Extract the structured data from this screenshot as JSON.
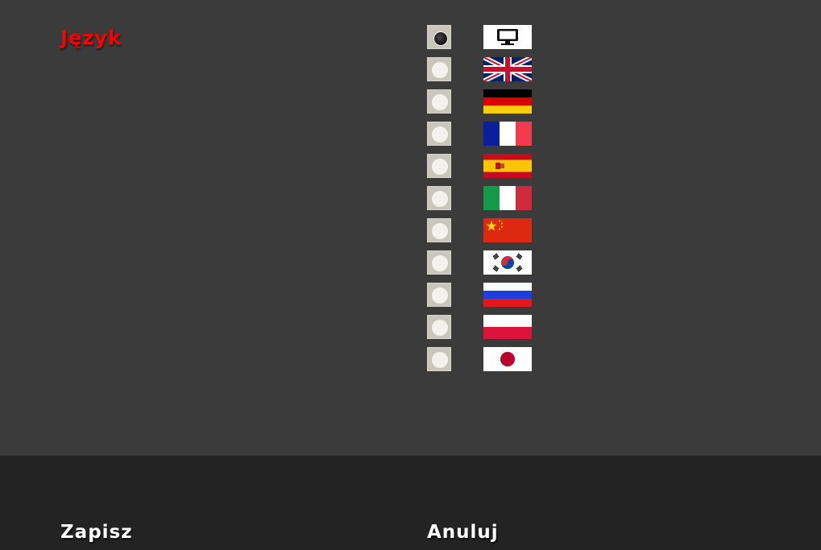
{
  "settings": {
    "title": "Język",
    "title_color": "#ff0000"
  },
  "languages": [
    {
      "flag": "monitor-icon",
      "selected": true
    },
    {
      "flag": "flag-uk",
      "selected": false
    },
    {
      "flag": "flag-germany",
      "selected": false
    },
    {
      "flag": "flag-france",
      "selected": false
    },
    {
      "flag": "flag-spain",
      "selected": false
    },
    {
      "flag": "flag-italy",
      "selected": false
    },
    {
      "flag": "flag-china",
      "selected": false
    },
    {
      "flag": "flag-south-korea",
      "selected": false
    },
    {
      "flag": "flag-russia",
      "selected": false
    },
    {
      "flag": "flag-poland",
      "selected": false
    },
    {
      "flag": "flag-japan",
      "selected": false
    }
  ],
  "footer": {
    "save_label": "Zapisz",
    "cancel_label": "Anuluj",
    "button_color": "#ffffff"
  }
}
